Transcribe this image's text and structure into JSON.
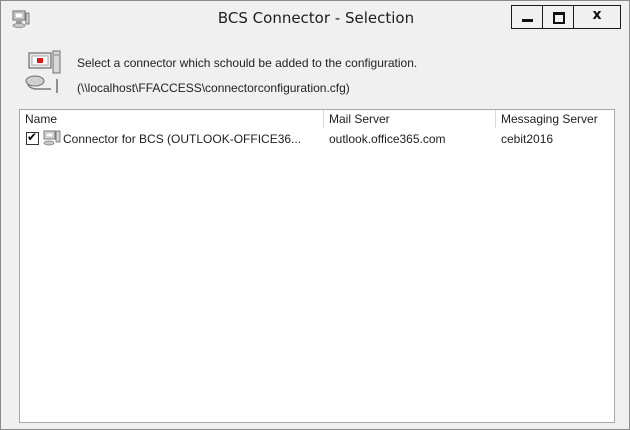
{
  "window": {
    "title": "BCS Connector - Selection",
    "close_label": "x"
  },
  "header": {
    "line1": "Select a connector which schould be added to the configuration.",
    "line2": "(\\\\localhost\\FFACCESS\\connectorconfiguration.cfg)"
  },
  "list": {
    "columns": [
      "Name",
      "Mail Server",
      "Messaging Server"
    ],
    "rows": [
      {
        "checked": true,
        "check_glyph": "✔",
        "icon": "connector-icon",
        "name": "Connector for BCS (OUTLOOK-OFFICE36...",
        "mail_server": "outlook.office365.com",
        "messaging_server": "cebit2016"
      }
    ]
  },
  "icons": {
    "title": "computer-network-icon",
    "header": "connector-plug-icon"
  }
}
